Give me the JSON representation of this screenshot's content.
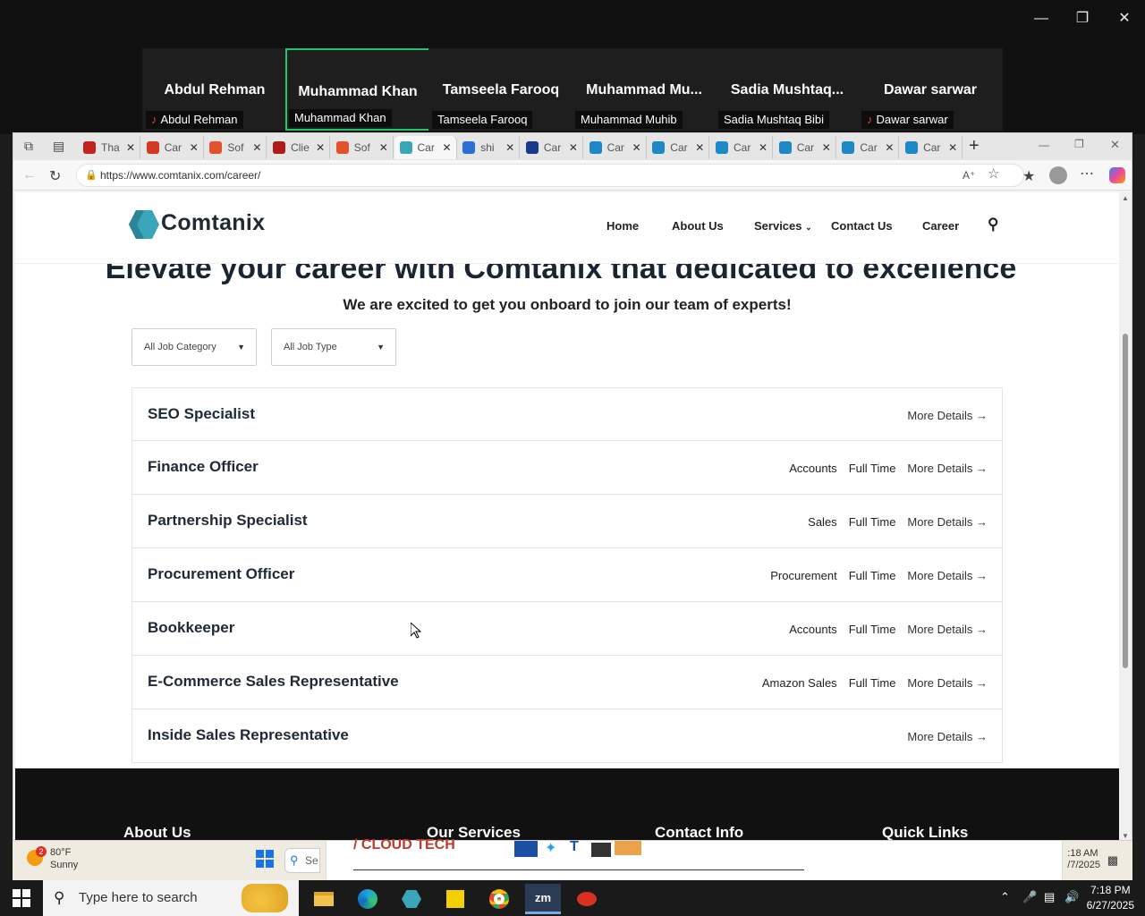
{
  "zoom": {
    "participants": [
      {
        "display": "Abdul Rehman",
        "label": "Abdul Rehman",
        "muted": true,
        "active": false
      },
      {
        "display": "Muhammad Khan",
        "label": "Muhammad Khan",
        "muted": false,
        "active": true
      },
      {
        "display": "Tamseela Farooq",
        "label": "Tamseela Farooq",
        "muted": false,
        "active": false
      },
      {
        "display": "Muhammad  Mu...",
        "label": "Muhammad Muhib",
        "muted": false,
        "active": false
      },
      {
        "display": "Sadia  Mushtaq...",
        "label": "Sadia Mushtaq Bibi",
        "muted": false,
        "active": false
      },
      {
        "display": "Dawar sarwar",
        "label": "Dawar sarwar",
        "muted": true,
        "active": false
      }
    ],
    "window_controls": [
      "minimize-icon",
      "restore-icon",
      "close-icon"
    ]
  },
  "browser": {
    "tabs": [
      {
        "label": "Tha",
        "icon": "thank-you-favicon",
        "color": "#c4221f",
        "active": false
      },
      {
        "label": "Car",
        "icon": "car-favicon",
        "color": "#d43a1f",
        "active": false
      },
      {
        "label": "Sof",
        "icon": "sofa-favicon",
        "color": "#e2522b",
        "active": false
      },
      {
        "label": "Clie",
        "icon": "client-favicon",
        "color": "#b01a1a",
        "active": false
      },
      {
        "label": "Sof",
        "icon": "sofa-favicon",
        "color": "#e2522b",
        "active": false
      },
      {
        "label": "Car",
        "icon": "comtanix-favicon",
        "color": "#3aa6b9",
        "active": true
      },
      {
        "label": "shi",
        "icon": "search-favicon",
        "color": "#2a6fd6",
        "active": false
      },
      {
        "label": "Car",
        "icon": "shi-favicon",
        "color": "#1a3a8c",
        "active": false
      },
      {
        "label": "Car",
        "icon": "w-favicon",
        "color": "#1e88c7",
        "active": false
      },
      {
        "label": "Car",
        "icon": "w-favicon",
        "color": "#1e88c7",
        "active": false
      },
      {
        "label": "Car",
        "icon": "w-favicon",
        "color": "#1e88c7",
        "active": false
      },
      {
        "label": "Car",
        "icon": "w-favicon",
        "color": "#1e88c7",
        "active": false
      },
      {
        "label": "Car",
        "icon": "w-favicon",
        "color": "#1e88c7",
        "active": false
      },
      {
        "label": "Car",
        "icon": "w-favicon",
        "color": "#1e88c7",
        "active": false
      }
    ],
    "url": "https://www.comtanix.com/career/"
  },
  "site": {
    "logo": "Comtanix",
    "nav": [
      "Home",
      "About Us",
      "Services",
      "Contact Us",
      "Career"
    ],
    "hero_title": "Elevate your career with Comtanix that dedicated to excellence",
    "hero_subtitle": "We are excited to get you onboard to join our team of experts!",
    "filters": {
      "category": "All Job Category",
      "type": "All Job Type"
    },
    "jobs": [
      {
        "title": "SEO Specialist",
        "department": "",
        "type": "",
        "link": "More Details →"
      },
      {
        "title": "Finance Officer",
        "department": "Accounts",
        "type": "Full Time",
        "link": "More Details →"
      },
      {
        "title": "Partnership Specialist",
        "department": "Sales",
        "type": "Full Time",
        "link": "More Details →"
      },
      {
        "title": "Procurement Officer",
        "department": "Procurement",
        "type": "Full Time",
        "link": "More Details →"
      },
      {
        "title": "Bookkeeper",
        "department": "Accounts",
        "type": "Full Time",
        "link": "More Details →"
      },
      {
        "title": "E-Commerce Sales Representative",
        "department": "Amazon Sales",
        "type": "Full Time",
        "link": "More Details →"
      },
      {
        "title": "Inside Sales Representative",
        "department": "",
        "type": "",
        "link": "More Details →"
      }
    ],
    "footer": [
      "About Us",
      "Our Services",
      "Contact Info",
      "Quick Links"
    ]
  },
  "shared_screen": {
    "weather_temp": "80°F",
    "weather_desc": "Sunny",
    "weather_badge": "2",
    "search_stub": "Se",
    "clock_time": ":18 AM",
    "clock_date": "/7/2025"
  },
  "taskbar": {
    "search_placeholder": "Type here to search",
    "time": "7:18 PM",
    "date": "6/27/2025",
    "apps": [
      "file-explorer-icon",
      "edge-icon",
      "comtanix-app-icon",
      "sticky-notes-icon",
      "chrome-icon",
      "zoom-icon",
      "snipping-icon"
    ]
  },
  "colors": {
    "accent": "#22c56a",
    "logo": "#3aa6b9",
    "dark": "#111111"
  }
}
